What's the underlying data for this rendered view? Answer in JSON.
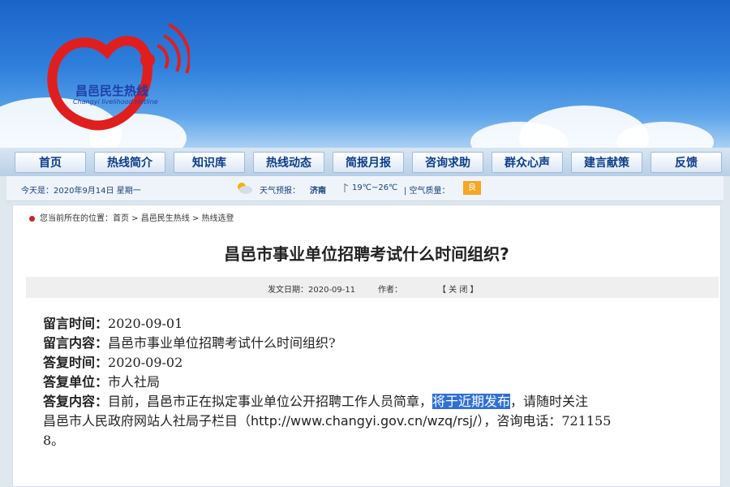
{
  "logo": {
    "cn": "昌邑民生热线",
    "en": "Changyi livelihood Hotline"
  },
  "nav": [
    "首页",
    "热线简介",
    "知识库",
    "热线动态",
    "简报月报",
    "咨询求助",
    "群众心声",
    "建言献策",
    "反馈"
  ],
  "infobar": {
    "date": "今天是：2020年9月14日 星期一",
    "weather_label": "天气预报：",
    "city": "济南",
    "temp": "19℃~26℃",
    "aqi_label": "| 空气质量：",
    "aqi_value": "良"
  },
  "breadcrumb": "您当前所在的位置：首页 > 昌邑民生热线 > 热线选登",
  "article": {
    "title": "昌邑市事业单位招聘考试什么时间组织?",
    "meta_date": "发文日期：2020-09-11",
    "meta_author": "作者：",
    "close": "【 关 闭 】"
  },
  "qa": {
    "msg_time_label": "留言时间：",
    "msg_time": "2020-09-01",
    "msg_content_label": "留言内容：",
    "msg_content": "昌邑市事业单位招聘考试什么时间组织?",
    "reply_time_label": "答复时间：",
    "reply_time": "2020-09-02",
    "reply_unit_label": "答复单位：",
    "reply_unit": "市人社局",
    "reply_content_label": "答复内容：",
    "reply_part1": "目前，昌邑市正在拟定事业单位公开招聘工作人员简章，",
    "reply_highlight": "将于近期发布",
    "reply_part2": "，请随时关注",
    "reply_line2a": "昌邑市人民政府网站人社局子栏目（",
    "reply_url": "http://www.changyi.gov.cn/wzq/rsj/",
    "reply_line2b": "），咨询电话：721155",
    "reply_line3": "8。"
  }
}
